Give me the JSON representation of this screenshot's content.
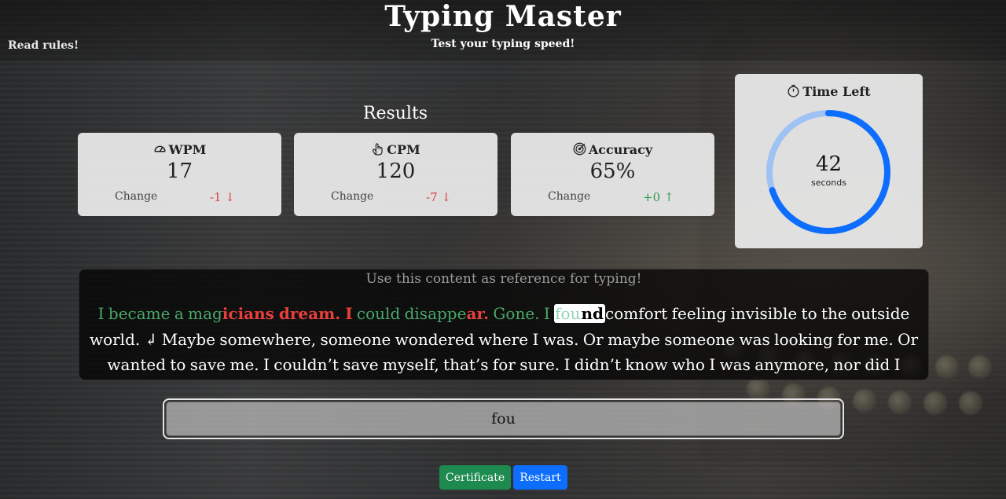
{
  "app": {
    "title": "Typing Master",
    "subtitle": "Test your typing speed!",
    "rules_link": "Read rules!"
  },
  "results": {
    "heading": "Results",
    "cards": [
      {
        "label": "WPM",
        "icon": "gauge-icon",
        "value": "17",
        "change_label": "Change",
        "change": "-1 ↓",
        "trend": "down"
      },
      {
        "label": "CPM",
        "icon": "pointer-hand-icon",
        "value": "120",
        "change_label": "Change",
        "change": "-7 ↓",
        "trend": "down"
      },
      {
        "label": "Accuracy",
        "icon": "target-icon",
        "value": "65%",
        "change_label": "Change",
        "change": "+0 ↑",
        "trend": "up"
      }
    ]
  },
  "timer": {
    "label": "Time Left",
    "icon": "stopwatch-icon",
    "value": "42",
    "unit": "seconds",
    "ring_color": "#0d6efd",
    "ring_track_color": "#9ec2f3"
  },
  "reference": {
    "hint": "Use this content as reference for typing!",
    "segments": [
      {
        "text": "I became a mag",
        "state": "correct"
      },
      {
        "text": "icians dream. I",
        "state": "wrong"
      },
      {
        "text": " could disappe",
        "state": "correct"
      },
      {
        "text": "ar.",
        "state": "wrong"
      },
      {
        "text": " Gone. I ",
        "state": "correct"
      },
      {
        "text": "fou",
        "state": "current-typed"
      },
      {
        "text": "nd",
        "state": "current-rest"
      },
      {
        "text": "comfort feeling invisible to the outside world. ↲ Maybe somewhere, someone wondered where I was. Or maybe someone was looking for me. Or wanted to save me. I couldn’t save myself, that’s for sure. I didn’t know who I was anymore, nor did I",
        "state": "pending"
      }
    ]
  },
  "input": {
    "value": "fou",
    "placeholder": ""
  },
  "buttons": {
    "certificate": "Certificate",
    "restart": "Restart"
  },
  "colors": {
    "correct": "#4aa86a",
    "wrong": "#e8403c",
    "certificate_button": "#1d8a4f",
    "restart_button": "#0d6efd"
  }
}
